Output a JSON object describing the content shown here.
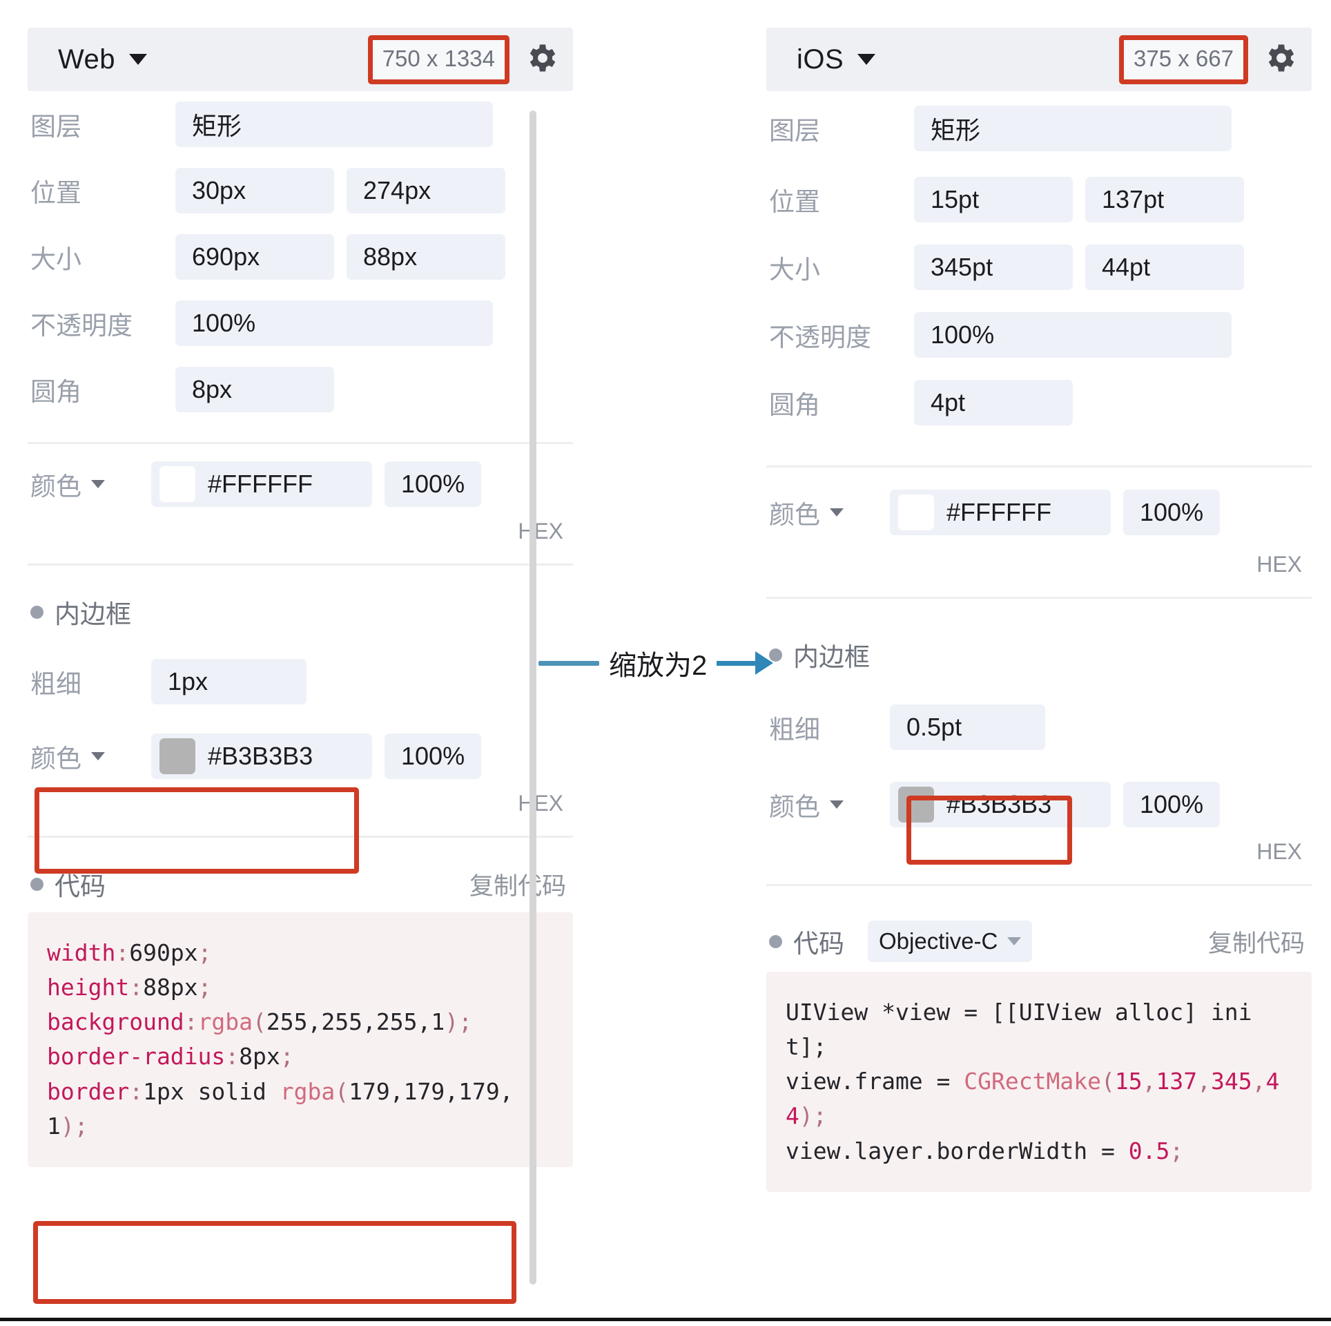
{
  "left_panel": {
    "platform": "Web",
    "canvas_size": "750 x 1334",
    "gear_icon": "gear-icon",
    "properties": [
      {
        "label": "图层",
        "values": [
          "矩形"
        ]
      },
      {
        "label": "位置",
        "values": [
          "30px",
          "274px"
        ]
      },
      {
        "label": "大小",
        "values": [
          "690px",
          "88px"
        ]
      },
      {
        "label": "不透明度",
        "values": [
          "100%"
        ]
      },
      {
        "label": "圆角",
        "values": [
          "8px"
        ]
      }
    ],
    "fill": {
      "label": "颜色",
      "hex": "#FFFFFF",
      "swatch_color": "#FFFFFF",
      "opacity": "100%",
      "mode": "HEX"
    },
    "border_section": {
      "title": "内边框",
      "width_label": "粗细",
      "width_value": "1px",
      "color_label": "颜色",
      "hex": "#B3B3B3",
      "swatch_color": "#B3B3B3",
      "opacity": "100%",
      "mode": "HEX"
    },
    "code_section": {
      "title": "代码",
      "copy_label": "复制代码",
      "lines": [
        {
          "parts": [
            {
              "t": "width",
              "c": "k"
            },
            {
              "t": ":",
              "c": "p"
            },
            {
              "t": "690px",
              "c": "n"
            },
            {
              "t": ";",
              "c": "p"
            }
          ]
        },
        {
          "parts": [
            {
              "t": "height",
              "c": "k"
            },
            {
              "t": ":",
              "c": "p"
            },
            {
              "t": "88px",
              "c": "n"
            },
            {
              "t": ";",
              "c": "p"
            }
          ]
        },
        {
          "parts": [
            {
              "t": "background",
              "c": "k"
            },
            {
              "t": ":",
              "c": "p"
            },
            {
              "t": "rgba",
              "c": "f"
            },
            {
              "t": "(",
              "c": "p"
            },
            {
              "t": "255,255,255,1",
              "c": "n"
            },
            {
              "t": ");",
              "c": "p"
            }
          ]
        },
        {
          "parts": [
            {
              "t": "border-radius",
              "c": "k"
            },
            {
              "t": ":",
              "c": "p"
            },
            {
              "t": "8px",
              "c": "n"
            },
            {
              "t": ";",
              "c": "p"
            }
          ]
        },
        {
          "parts": [
            {
              "t": "border",
              "c": "k"
            },
            {
              "t": ":",
              "c": "p"
            },
            {
              "t": "1px solid ",
              "c": "n"
            },
            {
              "t": "rgba",
              "c": "f"
            },
            {
              "t": "(",
              "c": "p"
            },
            {
              "t": "179,179,179,1",
              "c": "n"
            },
            {
              "t": ");",
              "c": "p"
            }
          ]
        }
      ]
    }
  },
  "right_panel": {
    "platform": "iOS",
    "canvas_size": "375 x 667",
    "gear_icon": "gear-icon",
    "properties": [
      {
        "label": "图层",
        "values": [
          "矩形"
        ]
      },
      {
        "label": "位置",
        "values": [
          "15pt",
          "137pt"
        ]
      },
      {
        "label": "大小",
        "values": [
          "345pt",
          "44pt"
        ]
      },
      {
        "label": "不透明度",
        "values": [
          "100%"
        ]
      },
      {
        "label": "圆角",
        "values": [
          "4pt"
        ]
      }
    ],
    "fill": {
      "label": "颜色",
      "hex": "#FFFFFF",
      "swatch_color": "#FFFFFF",
      "opacity": "100%",
      "mode": "HEX"
    },
    "border_section": {
      "title": "内边框",
      "width_label": "粗细",
      "width_value": "0.5pt",
      "color_label": "颜色",
      "hex": "#B3B3B3",
      "swatch_color": "#B3B3B3",
      "opacity": "100%",
      "mode": "HEX"
    },
    "code_section": {
      "title": "代码",
      "language": "Objective-C",
      "copy_label": "复制代码",
      "lines": [
        {
          "parts": [
            {
              "t": "UIView *view = [[UIView alloc] init];",
              "c": "n"
            }
          ]
        },
        {
          "parts": [
            {
              "t": "view.frame = ",
              "c": "n"
            },
            {
              "t": "CGRectMake",
              "c": "f"
            },
            {
              "t": "(",
              "c": "p"
            },
            {
              "t": "15",
              "c": "k"
            },
            {
              "t": ",",
              "c": "p"
            },
            {
              "t": "137",
              "c": "k"
            },
            {
              "t": ",",
              "c": "p"
            },
            {
              "t": "345",
              "c": "k"
            },
            {
              "t": ",",
              "c": "p"
            },
            {
              "t": "44",
              "c": "k"
            },
            {
              "t": ");",
              "c": "p"
            }
          ]
        },
        {
          "parts": [
            {
              "t": "view.layer.borderWidth = ",
              "c": "n"
            },
            {
              "t": "0.5",
              "c": "k"
            },
            {
              "t": ";",
              "c": "p"
            }
          ]
        }
      ]
    }
  },
  "annotation": {
    "text": "缩放为2",
    "line_color": "#4e93b8",
    "arrow_color": "#2f87b8"
  },
  "highlight_color": "#cf3a23"
}
